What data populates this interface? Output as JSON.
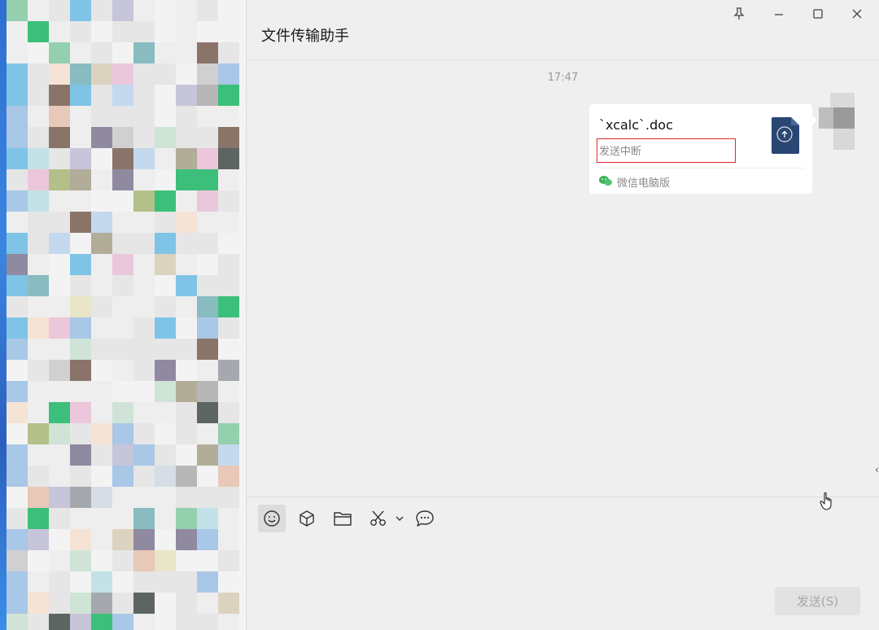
{
  "window": {
    "title": "文件传输助手"
  },
  "controls": [
    "pin-icon",
    "minimize-icon",
    "maximize-icon",
    "close-icon"
  ],
  "chat": {
    "timestamp": "17:47",
    "file_card": {
      "file_name": "`xcalc`.doc",
      "status": "发送中断",
      "source": "微信电脑版",
      "icon": "doc-upload-icon",
      "icon_color": "#2a4672"
    }
  },
  "toolbar": {
    "tools": [
      "emoji-icon",
      "box-icon",
      "folder-icon",
      "scissors-icon",
      "chat-history-icon"
    ]
  },
  "send_button": {
    "label": "发送(S)"
  },
  "colors": {
    "accent_red": "#e0272c",
    "wechat_green": "#3cb35a"
  }
}
